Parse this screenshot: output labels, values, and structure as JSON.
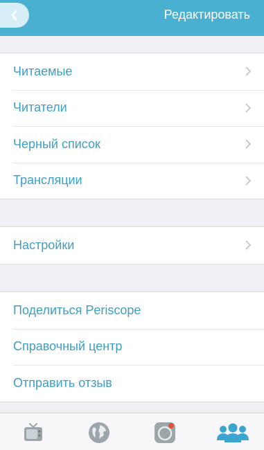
{
  "header": {
    "back_icon": "chevron-left-icon",
    "action_label": "Редактировать"
  },
  "groups": [
    {
      "items": [
        {
          "label": "Читаемые",
          "chevron": true
        },
        {
          "label": "Читатели",
          "chevron": true
        },
        {
          "label": "Черный список",
          "chevron": true
        },
        {
          "label": "Трансляции",
          "chevron": true
        }
      ]
    },
    {
      "items": [
        {
          "label": "Настройки",
          "chevron": true
        }
      ]
    },
    {
      "items": [
        {
          "label": "Поделиться Periscope",
          "chevron": false
        },
        {
          "label": "Справочный центр",
          "chevron": false
        },
        {
          "label": "Отправить отзыв",
          "chevron": false
        }
      ]
    }
  ],
  "tabbar": {
    "tabs": [
      {
        "icon": "tv-icon",
        "active": false
      },
      {
        "icon": "globe-icon",
        "active": false
      },
      {
        "icon": "broadcast-camera-icon",
        "active": false
      },
      {
        "icon": "people-icon",
        "active": true
      }
    ]
  },
  "colors": {
    "header_bg": "#4ab0d1",
    "accent_text": "#3d9fc3",
    "background": "#efeff4",
    "active_tab": "#3aa6cf",
    "inactive_tab": "#9aa6aa"
  }
}
